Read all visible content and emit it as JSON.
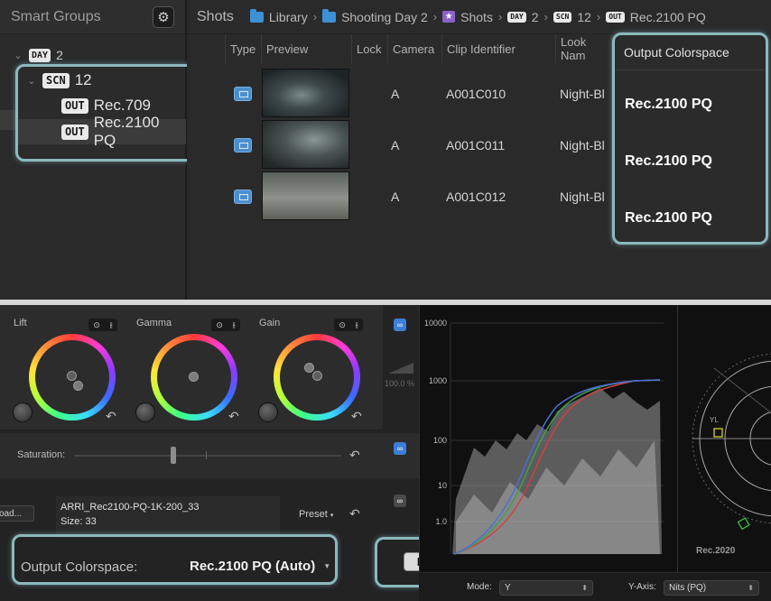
{
  "sidebar": {
    "title": "Smart Groups",
    "day": {
      "badge": "DAY",
      "label": "2"
    },
    "scene": {
      "badge": "SCN",
      "label": "12"
    },
    "outputs": [
      {
        "badge": "OUT",
        "label": "Rec.709"
      },
      {
        "badge": "OUT",
        "label": "Rec.2100 PQ"
      }
    ]
  },
  "breadcrumb": {
    "title": "Shots",
    "library": "Library",
    "shooting_day": "Shooting Day 2",
    "shots": "Shots",
    "day_badge": "DAY",
    "day": "2",
    "scn_badge": "SCN",
    "scene": "12",
    "out_badge": "OUT",
    "output": "Rec.2100 PQ",
    "separator": "›"
  },
  "table": {
    "columns": {
      "type": "Type",
      "preview": "Preview",
      "lock": "Lock",
      "camera": "Camera",
      "clip": "Clip Identifier",
      "look": "Look Nam",
      "output": "Output Colorspace"
    },
    "rows": [
      {
        "camera": "A",
        "clip": "A001C010",
        "look": "Night-Bl",
        "output": "Rec.2100 PQ"
      },
      {
        "camera": "A",
        "clip": "A001C011",
        "look": "Night-Bl",
        "output": "Rec.2100 PQ"
      },
      {
        "camera": "A",
        "clip": "A001C012",
        "look": "Night-Bl",
        "output": "Rec.2100 PQ"
      }
    ]
  },
  "color": {
    "wheels": [
      {
        "label": "Lift"
      },
      {
        "label": "Gamma"
      },
      {
        "label": "Gain"
      }
    ],
    "wheel_tool_icons": [
      "target-icon",
      "sliders-icon"
    ],
    "range_readout": "100.0 %",
    "saturation_label": "Saturation:",
    "saturation_level": 0.5,
    "lut": {
      "load_button": "oad...",
      "name": "ARRI_Rec2100-PQ-1K-200_33",
      "size_label": "Size:",
      "size_value": "33",
      "preset_label": "Preset"
    },
    "output_colorspace": {
      "label": "Output Colorspace:",
      "value": "Rec.2100 PQ (Auto)"
    },
    "pq_button": "PQ"
  },
  "scope": {
    "y_labels": [
      "10000",
      "1000",
      "100",
      "10",
      "1.0"
    ],
    "vectorscope_label": "Rec.2020",
    "vector_target_label": "YL",
    "mode_label": "Mode:",
    "mode_value": "Y",
    "yaxis_label": "Y-Axis:",
    "yaxis_value": "Nits (PQ)"
  },
  "colors": {
    "highlight": "#8ab9bd",
    "accent_blue": "#3d7fd8",
    "badge_bg": "#e9e9e9"
  }
}
